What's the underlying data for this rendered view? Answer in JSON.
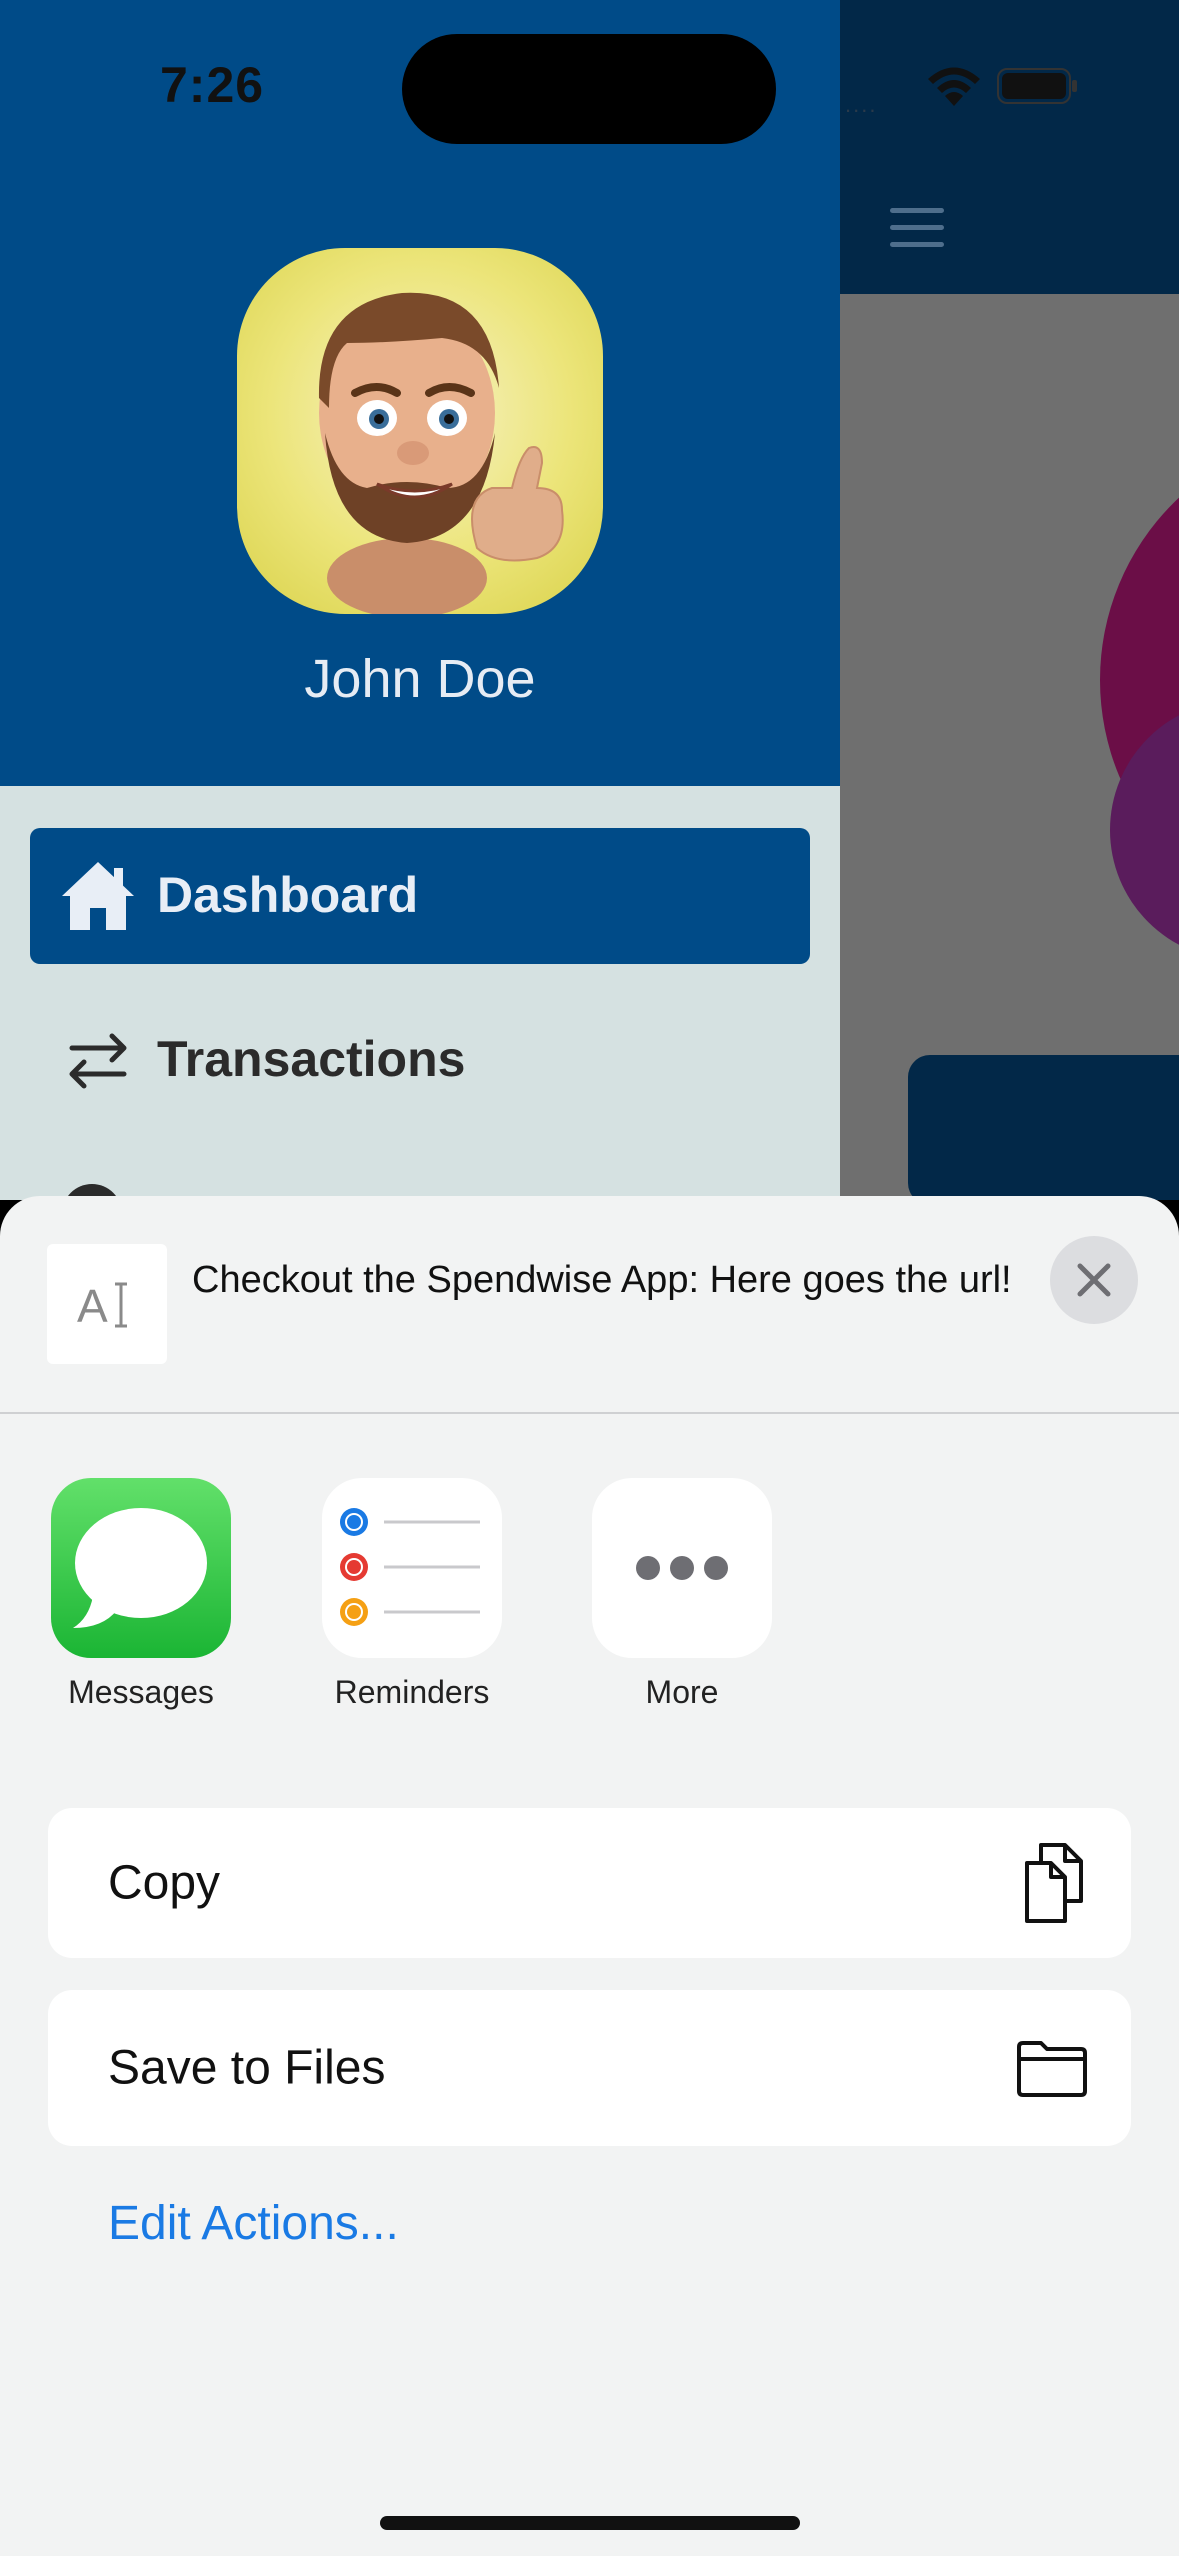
{
  "status_bar": {
    "time": "7:26",
    "signal": "....",
    "icons": [
      "wifi-icon",
      "battery-icon"
    ]
  },
  "background_app": {
    "menu_icon": "hamburger-icon",
    "add_button_glyph": "+"
  },
  "drawer": {
    "user_name": "John Doe",
    "avatar": "memoji-avatar",
    "items": [
      {
        "label": "Dashboard",
        "icon": "home-icon",
        "active": true
      },
      {
        "label": "Transactions",
        "icon": "transfer-arrows-icon",
        "active": false
      }
    ]
  },
  "share_sheet": {
    "preview": {
      "thumbnail_icon": "text-document-icon",
      "text": "Checkout the Spendwise App: Here goes the url!"
    },
    "close_icon": "close-icon",
    "apps": [
      {
        "label": "Messages",
        "icon": "messages-icon"
      },
      {
        "label": "Reminders",
        "icon": "reminders-icon"
      },
      {
        "label": "More",
        "icon": "more-icon"
      }
    ],
    "actions": [
      {
        "label": "Copy",
        "icon": "copy-icon"
      },
      {
        "label": "Save to Files",
        "icon": "folder-icon"
      }
    ],
    "edit_actions": "Edit Actions..."
  },
  "colors": {
    "drawer_header": "#004B88",
    "drawer_body": "#D5E1E1",
    "app_header": "#022848",
    "sheet_background": "#F2F3F3",
    "link_blue": "#1A7AE4"
  }
}
